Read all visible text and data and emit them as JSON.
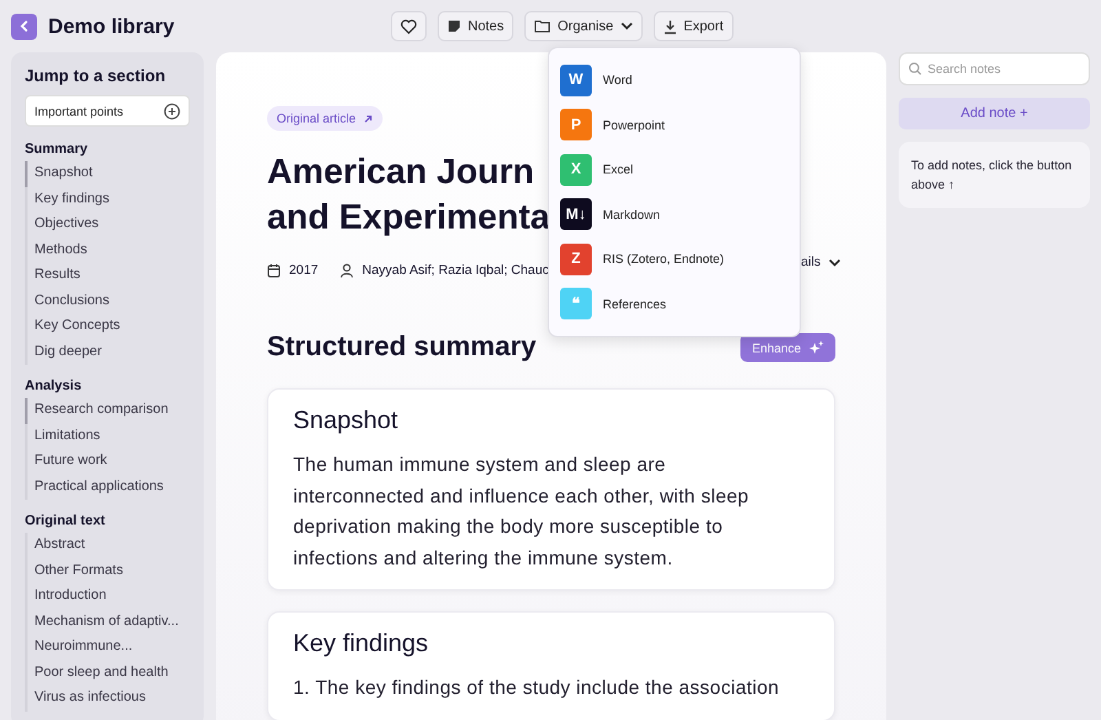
{
  "header": {
    "title": "Demo library"
  },
  "toolbar": [
    {
      "kind": "heart"
    },
    {
      "kind": "notes",
      "label": "Notes"
    },
    {
      "kind": "organise",
      "label": "Organise"
    },
    {
      "kind": "export",
      "label": "Export"
    }
  ],
  "sidebar": {
    "title": "Jump to a section",
    "important": "Important points",
    "groups": [
      {
        "title": "Summary",
        "items": [
          {
            "label": "Snapshot",
            "active": true
          },
          {
            "label": "Key findings",
            "active": false
          },
          {
            "label": "Objectives",
            "active": false
          },
          {
            "label": "Methods",
            "active": false
          },
          {
            "label": "Results",
            "active": false
          },
          {
            "label": "Conclusions",
            "active": false
          },
          {
            "label": "Key Concepts",
            "active": false
          },
          {
            "label": "Dig deeper",
            "active": false
          }
        ]
      },
      {
        "title": "Analysis",
        "items": [
          {
            "label": "Research comparison",
            "active": true
          },
          {
            "label": "Limitations",
            "active": false
          },
          {
            "label": "Future work",
            "active": false
          },
          {
            "label": "Practical applications",
            "active": false
          }
        ]
      },
      {
        "title": "Original text",
        "items": [
          {
            "label": "Abstract",
            "active": false
          },
          {
            "label": "Other Formats",
            "active": false
          },
          {
            "label": "Introduction",
            "active": false
          },
          {
            "label": "Mechanism of adaptiv...",
            "active": false
          },
          {
            "label": "Neuroimmune...",
            "active": false
          },
          {
            "label": "Poor sleep and health",
            "active": false
          },
          {
            "label": "Virus as infectious",
            "active": false
          }
        ]
      }
    ]
  },
  "article": {
    "badge": "Original article",
    "title_lines": [
      "American Journ",
      "and Experimenta"
    ],
    "year": "2017",
    "authors": "Nayyab Asif; Razia Iqbal; Chauc",
    "details": "ails"
  },
  "summary": {
    "heading": "Structured summary",
    "enhance": "Enhance",
    "cards": [
      {
        "title": "Snapshot",
        "body": "The human immune system and sleep are interconnected and influence each other, with sleep deprivation making the body more susceptible to infections and altering the immune system."
      },
      {
        "title": "Key findings",
        "body": "1. The key findings of the study include the association"
      }
    ]
  },
  "export_menu": [
    {
      "kind": "word",
      "letter": "W",
      "label": "Word"
    },
    {
      "kind": "powerpoint",
      "letter": "P",
      "label": "Powerpoint"
    },
    {
      "kind": "excel",
      "letter": "X",
      "label": "Excel"
    },
    {
      "kind": "markdown",
      "letter": "M↓",
      "label": "Markdown"
    },
    {
      "kind": "ris",
      "letter": "Z",
      "label": "RIS (Zotero, Endnote)"
    },
    {
      "kind": "references",
      "letter": "❝",
      "label": "References"
    }
  ],
  "notes": {
    "placeholder": "Search notes",
    "add": "Add note +",
    "hint": "To add notes, click the button above ↑"
  }
}
